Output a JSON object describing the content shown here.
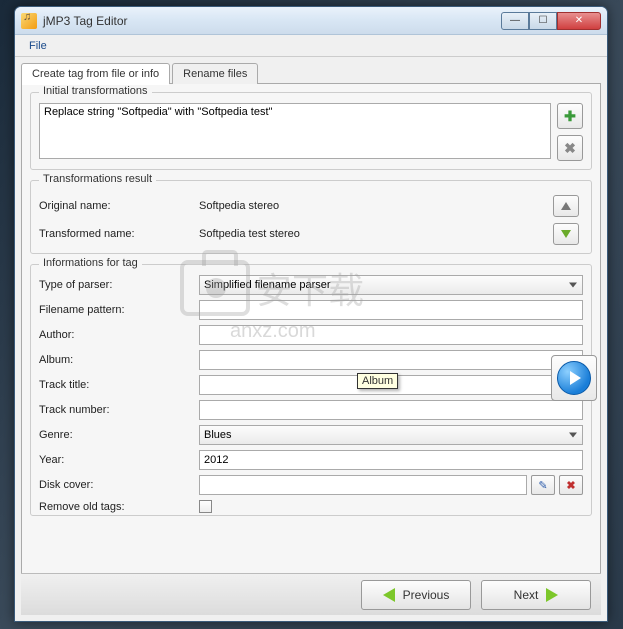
{
  "window": {
    "title": "jMP3 Tag Editor"
  },
  "menubar": {
    "file": "File"
  },
  "tabs": {
    "create": "Create tag from file or info",
    "rename": "Rename files"
  },
  "group_initial": {
    "title": "Initial transformations",
    "item1": "Replace string \"Softpedia\" with \"Softpedia test\""
  },
  "group_result": {
    "title": "Transformations result",
    "orig_label": "Original name:",
    "orig_value": "Softpedia stereo",
    "trans_label": "Transformed name:",
    "trans_value": "Softpedia test stereo"
  },
  "group_info": {
    "title": "Informations for tag",
    "parser_label": "Type of parser:",
    "parser_value": "Simplified filename parser",
    "pattern_label": "Filename pattern:",
    "pattern_value": "",
    "author_label": "Author:",
    "author_value": "",
    "album_label": "Album:",
    "album_value": "",
    "tracktitle_label": "Track title:",
    "tracktitle_value": "",
    "tracknum_label": "Track number:",
    "tracknum_value": "",
    "genre_label": "Genre:",
    "genre_value": "Blues",
    "year_label": "Year:",
    "year_value": "2012",
    "disk_label": "Disk cover:",
    "disk_value": "",
    "remove_label": "Remove old tags:"
  },
  "tooltip": "Album",
  "footer": {
    "previous": "Previous",
    "next": "Next"
  },
  "watermark": {
    "main": "安下载",
    "sub": "anxz.com"
  }
}
